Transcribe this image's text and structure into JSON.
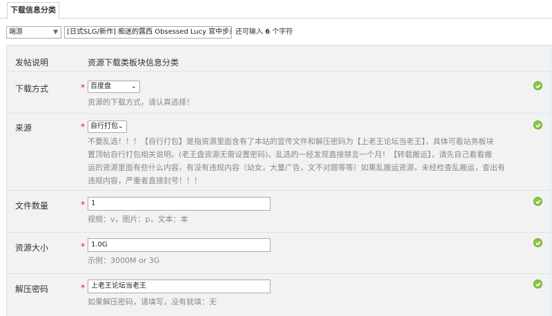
{
  "tabs": [
    {
      "label": "下载信息分类"
    }
  ],
  "post": {
    "type_select": "端游",
    "title": "[日式SLG/新作] 痴迷的露西 Obsessed Lucy 官中步兵版 [",
    "remain_prefix": "还可输入",
    "remain_count": "6",
    "remain_suffix": "个字符"
  },
  "form": {
    "intro": {
      "label": "发帖说明",
      "text": "资源下载类板块信息分类"
    },
    "download": {
      "label": "下载方式",
      "value": "百度盘",
      "hint": "资源的下载方式，请认真选择！"
    },
    "source": {
      "label": "来源",
      "value": "自行打包",
      "hint_lines": [
        "不要乱选！！！【自行打包】是指资源里面含有了本站的宣传文件和解压密码为【上老王论坛当老王】，具体可看站务板块",
        "置顶帖自行打包相关说明。(老王盘资源无需设置密码)。乱选的一经发现直接禁言一个月！【转载搬运】，请先自己看看搬",
        "运的资源里面有些什么内容，有没有违规内容（幼女，大量广告，文不对题等等）如果乱搬运资源，未经检查乱搬运，查出有",
        "违规内容，严重者直接封号！！！"
      ]
    },
    "file_count": {
      "label": "文件数量",
      "value": "1",
      "hint": "视频：v，图片：p，文本：本"
    },
    "size": {
      "label": "资源大小",
      "value": "1.0G",
      "hint": "示例：3000M or 3G"
    },
    "password": {
      "label": "解压密码",
      "value": "上老王论坛当老王",
      "hint": "如果解压密码，请填写，没有就填：无"
    }
  },
  "required_mark": "*",
  "colors": {
    "check": "#8cc63e",
    "required": "#e01919",
    "panel": "#f2f2f2"
  }
}
